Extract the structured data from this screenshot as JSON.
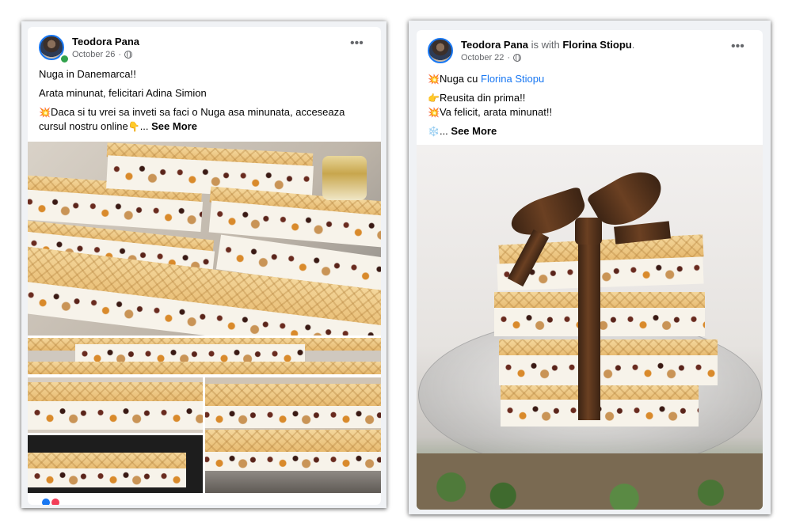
{
  "left_post": {
    "author": "Teodora Pana",
    "date": "October 26",
    "lines": [
      "Nuga in Danemarca!!",
      "Arata minunat, felicitari Adina Simion"
    ],
    "body_emoji": "💥",
    "body_text": "Daca si tu vrei sa inveti sa faci o Nuga asa minunata, acceseaza cursul nostru online",
    "pointing_emoji": "👇",
    "ellipsis": "... ",
    "see_more": "See More",
    "more_label": "•••"
  },
  "right_post": {
    "author": "Teodora Pana",
    "with_text": " is with ",
    "tagged": "Florina Stiopu",
    "tagged_period": ".",
    "date": "October 22",
    "line1_emoji": "💥",
    "line1_prefix": "Nuga cu ",
    "line1_mention": "Florina Stiopu",
    "line2_emoji": "👉",
    "line2": "Reusita din prima!!",
    "line3_emoji": "💥",
    "line3": "Va felicit, arata minunat!!",
    "line4_emoji": "❄️",
    "ellipsis": "... ",
    "see_more": "See More",
    "more_label": "•••"
  },
  "colors": {
    "link_blue": "#1877f2",
    "meta_gray": "#65676b",
    "online_green": "#31a24c"
  },
  "icons": [
    "globe-icon",
    "more-options-icon",
    "online-status-dot"
  ]
}
